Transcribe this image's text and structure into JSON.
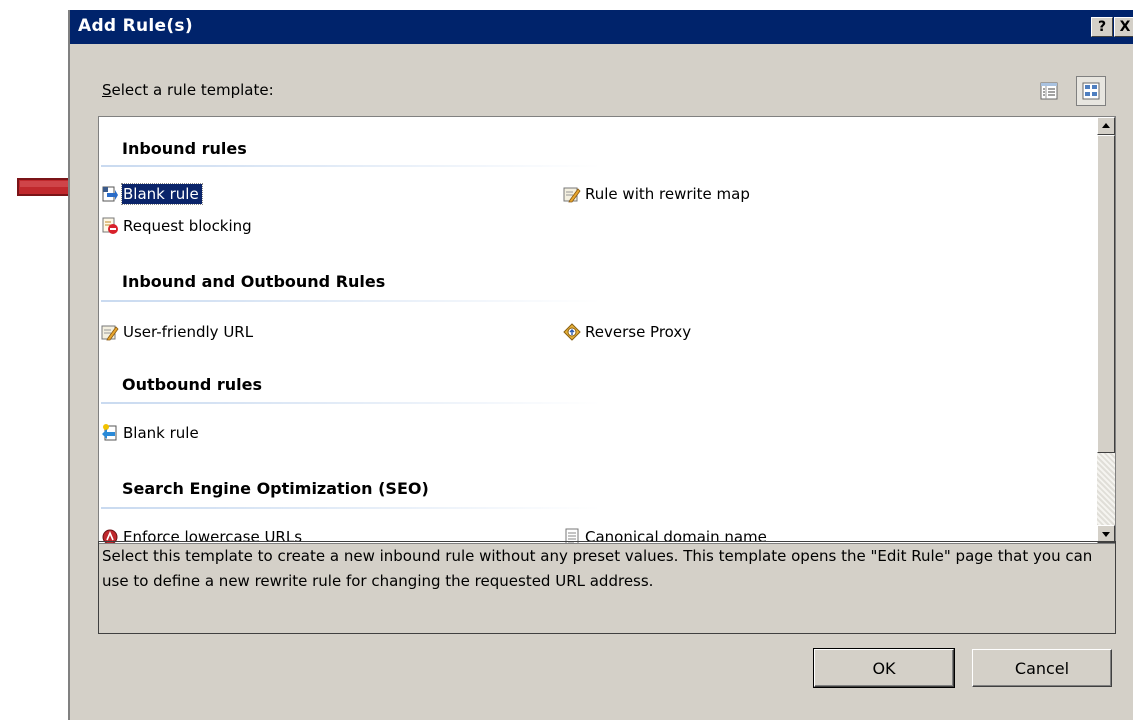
{
  "dialog": {
    "title": "Add Rule(s)",
    "help_button": "?",
    "close_button": "X",
    "select_label_accel": "S",
    "select_label_rest": "elect a rule template:",
    "description": "Select this template to create a new inbound rule without any preset values. This template opens the \"Edit Rule\" page that you can use to define a new rewrite rule for changing the requested URL address.",
    "ok_label": "OK",
    "cancel_label": "Cancel"
  },
  "groups": [
    {
      "header": "Inbound rules",
      "items": [
        {
          "label": "Blank rule",
          "icon": "blank-rule-icon",
          "selected": true
        },
        {
          "label": "Rule with rewrite map",
          "icon": "rewrite-map-icon"
        },
        {
          "label": "Request blocking",
          "icon": "request-blocking-icon"
        }
      ]
    },
    {
      "header": "Inbound and Outbound Rules",
      "items": [
        {
          "label": "User-friendly URL",
          "icon": "user-friendly-url-icon"
        },
        {
          "label": "Reverse Proxy",
          "icon": "reverse-proxy-icon"
        }
      ]
    },
    {
      "header": "Outbound rules",
      "items": [
        {
          "label": "Blank rule",
          "icon": "outbound-blank-rule-icon"
        }
      ]
    },
    {
      "header": "Search Engine Optimization (SEO)",
      "items": [
        {
          "label": "Enforce lowercase URLs",
          "icon": "enforce-lowercase-icon"
        },
        {
          "label": "Canonical domain name",
          "icon": "canonical-domain-icon"
        }
      ]
    }
  ],
  "colors": {
    "titlebar": "#00236b",
    "selection": "#0a246a",
    "dialog_bg": "#d4d0c8",
    "arrow": "#c0282d"
  }
}
